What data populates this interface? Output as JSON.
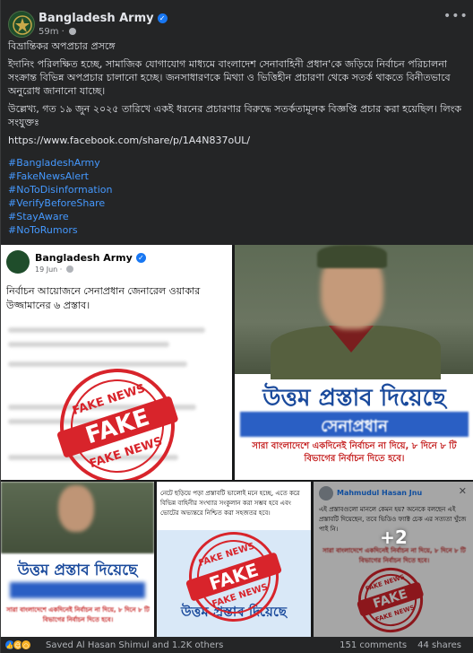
{
  "page": {
    "name": "Bangladesh Army",
    "time": "59m",
    "privacy_icon": "globe-icon",
    "more_icon": "more-options-icon"
  },
  "post": {
    "title": "বিভ্রান্তিকর অপপ্রচার প্রসঙ্গে",
    "paragraph1": "ইদানিং পরিলক্ষিত হচ্ছে, সামাজিক যোগাযোগ মাধ্যমে বাংলাদেশ সেনাবাহিনী প্রধান'কে জড়িয়ে নির্বাচন পরিচালনা সংক্রান্ত বিভিন্ন অপপ্রচার চালানো হচ্ছে। জনসাধারণকে মিথ্যা ও ভিত্তিহীন প্রচারণা থেকে সতর্ক থাকতে বিনীতভাবে অনুরোধ জানানো যাচ্ছে।",
    "paragraph2": "উল্লেখ্য, গত ১৯ জুন ২০২৫ তারিখে একই ধরনের প্রচারণার বিরুদ্ধে সতর্কতামূলক বিজ্ঞপ্তি প্রচার করা হয়েছিল। লিংক সংযুক্তঃ",
    "link": "https://www.facebook.com/share/p/1A4N837oUL/",
    "hashtags": [
      "#BangladeshArmy",
      "#FakeNewsAlert",
      "#NoToDisinformation",
      "#VerifyBeforeShare",
      "#StayAware",
      "#NoToRumors"
    ]
  },
  "media": {
    "tile1": {
      "page_name": "Bangladesh Army",
      "date": "19 Jun",
      "text": "নির্বাচন আয়োজনে সেনাপ্রধান জেনারেল ওয়াকার উজ্জামানের ৬ প্রস্তাব।",
      "stamp_top": "FAKE NEWS",
      "stamp_mid": "FAKE",
      "stamp_bot": "FAKE NEWS"
    },
    "tile2": {
      "headline": "উত্তম প্রস্তাব দিয়েছে",
      "subheadline": "সেনাপ্রধান",
      "red_text": "সারা বাংলাদেশে একদিনেই নির্বাচন না দিয়ে, ৮ দিনে ৮ টি বিভাগের নির্বাচন দিতে হবে।"
    },
    "tile3": {
      "headline": "উত্তম প্রস্তাব দিয়েছে",
      "red_text": "সারা বাংলাদেশে একদিনেই নির্বাচন না দিয়ে, ৮ দিনে ৮ টি বিভাগের নির্বাচন দিতে হবে।"
    },
    "tile4": {
      "text": "নেটে ছড়িয়ে পড়া প্রস্তাবটি ভালোই মনে হচ্ছে, এতে করে বিভিন্ন বাহিনীর সংখ্যার সংকুলান করা সম্ভব হবে এবং ভোটের অভ্যন্তরে নিশ্চিত করা সহজতর হবে।",
      "headline": "উত্তম প্রস্তাব দিয়েছে",
      "stamp_top": "FAKE NEWS",
      "stamp_mid": "FAKE",
      "stamp_bot": "FAKE NEWS"
    },
    "tile5": {
      "user_name": "Mahmudul Hasan Jnu",
      "text": "এই প্রস্তাবগুলো মানলে কেমন হয়? অনেকে বলছেন এই প্রস্তাবটি দিয়েছেন, তবে ভিডিও ফ্যাক্ট চেক এর সত্যতা খুঁজে পাই নি।",
      "red_text": "সারা বাংলাদেশে একদিনেই নির্বাচন না দিয়ে, ৮ দিনে ৮ টি বিভাগের নির্বাচন দিতে হবে।",
      "more_count": "+2",
      "stamp_top": "FAKE NEWS",
      "stamp_mid": "FAKE",
      "stamp_bot": "FAKE NEWS"
    }
  },
  "footer": {
    "reactions": [
      "like",
      "haha",
      "wow"
    ],
    "reacted_by": "Saved Al Hasan Shimul and 1.2K others",
    "comments": "151 comments",
    "shares": "44 shares"
  },
  "colors": {
    "background": "#242526",
    "hashtag": "#4599ff",
    "fake_red": "#d8242b",
    "headline_blue": "#1a4a9c"
  }
}
